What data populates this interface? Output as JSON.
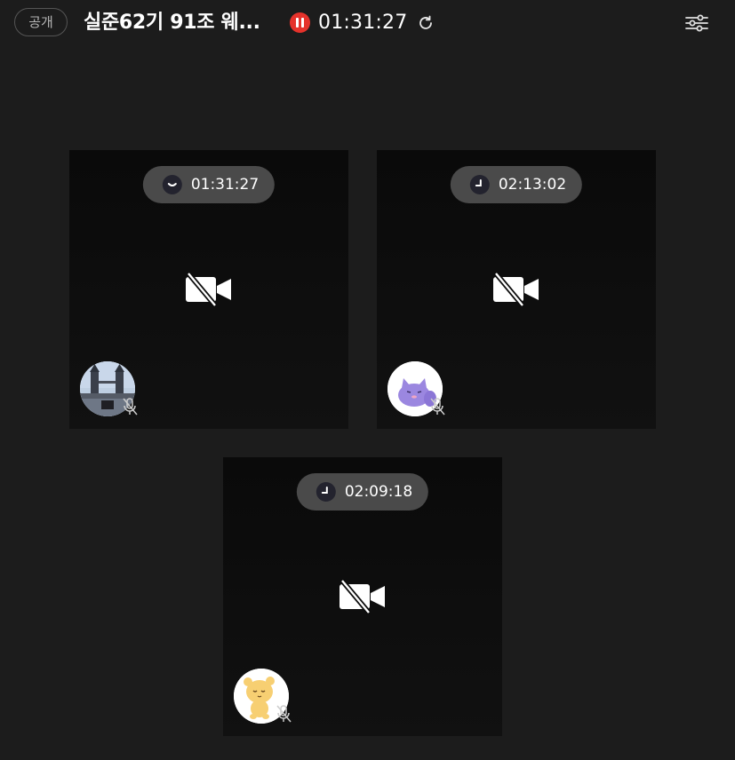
{
  "header": {
    "public_badge": "공개",
    "title": "실준62기 91조 웨...",
    "timer": "01:31:27",
    "recording_color": "#e5322b"
  },
  "participants": [
    {
      "timer": "01:31:27",
      "avatar": "tower-bridge-photo",
      "mic": "muted",
      "camera": "off"
    },
    {
      "timer": "02:13:02",
      "avatar": "purple-cat-character",
      "mic": "muted",
      "camera": "off"
    },
    {
      "timer": "02:09:18",
      "avatar": "yellow-bear-character",
      "mic": "muted",
      "camera": "off"
    }
  ],
  "icons": {
    "refresh": "refresh-icon",
    "settings": "sliders-icon",
    "camera_off": "video-off-icon",
    "mic_off": "mic-off-icon",
    "clock": "clock-icon"
  }
}
